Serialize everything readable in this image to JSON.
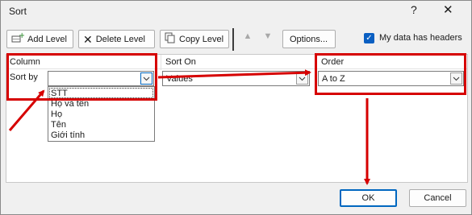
{
  "window": {
    "title": "Sort",
    "help": "?",
    "close": "✕"
  },
  "toolbar": {
    "add_level": "Add Level",
    "delete_level": "Delete Level",
    "copy_level": "Copy Level",
    "options": "Options...",
    "move_up": "▲",
    "move_down": "▼",
    "my_data_has_headers": "My data has headers",
    "headers_checked": true
  },
  "columns": {
    "column": "Column",
    "sort_on": "Sort On",
    "order": "Order"
  },
  "row": {
    "sort_by": "Sort by",
    "column_value": "",
    "sort_on_value": "Values",
    "order_value": "A to Z"
  },
  "column_options": [
    "STT",
    "Họ và tên",
    "Họ",
    "Tên",
    "Giới tính"
  ],
  "buttons": {
    "ok": "OK",
    "cancel": "Cancel"
  },
  "colors": {
    "annotation": "#d60000",
    "accent": "#0067c0"
  }
}
